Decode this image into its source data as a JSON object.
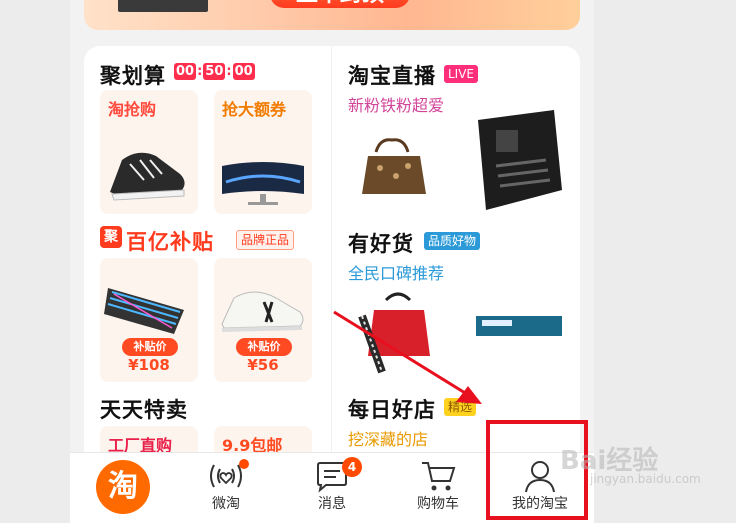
{
  "banner": {
    "button_text": "上不封顶"
  },
  "left": {
    "juhuasuan": {
      "title": "聚划算",
      "timer": [
        "00",
        "50",
        "00"
      ],
      "tiles": [
        {
          "label": "淘抢购",
          "label_color": "#ff4a3d"
        },
        {
          "label": "抢大额券",
          "label_color": "#f07b00"
        }
      ]
    },
    "baiyi": {
      "icon_char": "聚",
      "title": "百亿补贴",
      "badge": "品牌正品",
      "tiles": [
        {
          "pill": "补贴价",
          "price": "¥108"
        },
        {
          "pill": "补贴价",
          "price": "¥56"
        }
      ]
    },
    "tiantian": {
      "title": "天天特卖",
      "tiles": [
        {
          "label": "工厂直购",
          "label_color": "#e8204a"
        },
        {
          "label": "9.9包邮",
          "label_color": "#ff4a22"
        }
      ]
    }
  },
  "right": {
    "live": {
      "title": "淘宝直播",
      "badge": "LIVE",
      "subtitle": "新粉铁粉超爱",
      "subtitle_color": "#d0459a"
    },
    "haohuo": {
      "title": "有好货",
      "badge": "品质好物",
      "subtitle": "全民口碑推荐",
      "subtitle_color": "#2c9ad8"
    },
    "shop": {
      "title": "每日好店",
      "badge": "精选",
      "subtitle": "挖深藏的店",
      "subtitle_color": "#e89a00"
    }
  },
  "tabbar": {
    "items": [
      {
        "label": "",
        "logo_char": "淘"
      },
      {
        "label": "微淘"
      },
      {
        "label": "消息",
        "badge": "4"
      },
      {
        "label": "购物车"
      },
      {
        "label": "我的淘宝"
      }
    ]
  },
  "watermark": {
    "text": "Bai经验",
    "sub": "jingyan.baidu.com"
  },
  "colors": {
    "accent": "#ff4a22",
    "highlight": "#e8101e",
    "arrow": "#e8101e"
  }
}
